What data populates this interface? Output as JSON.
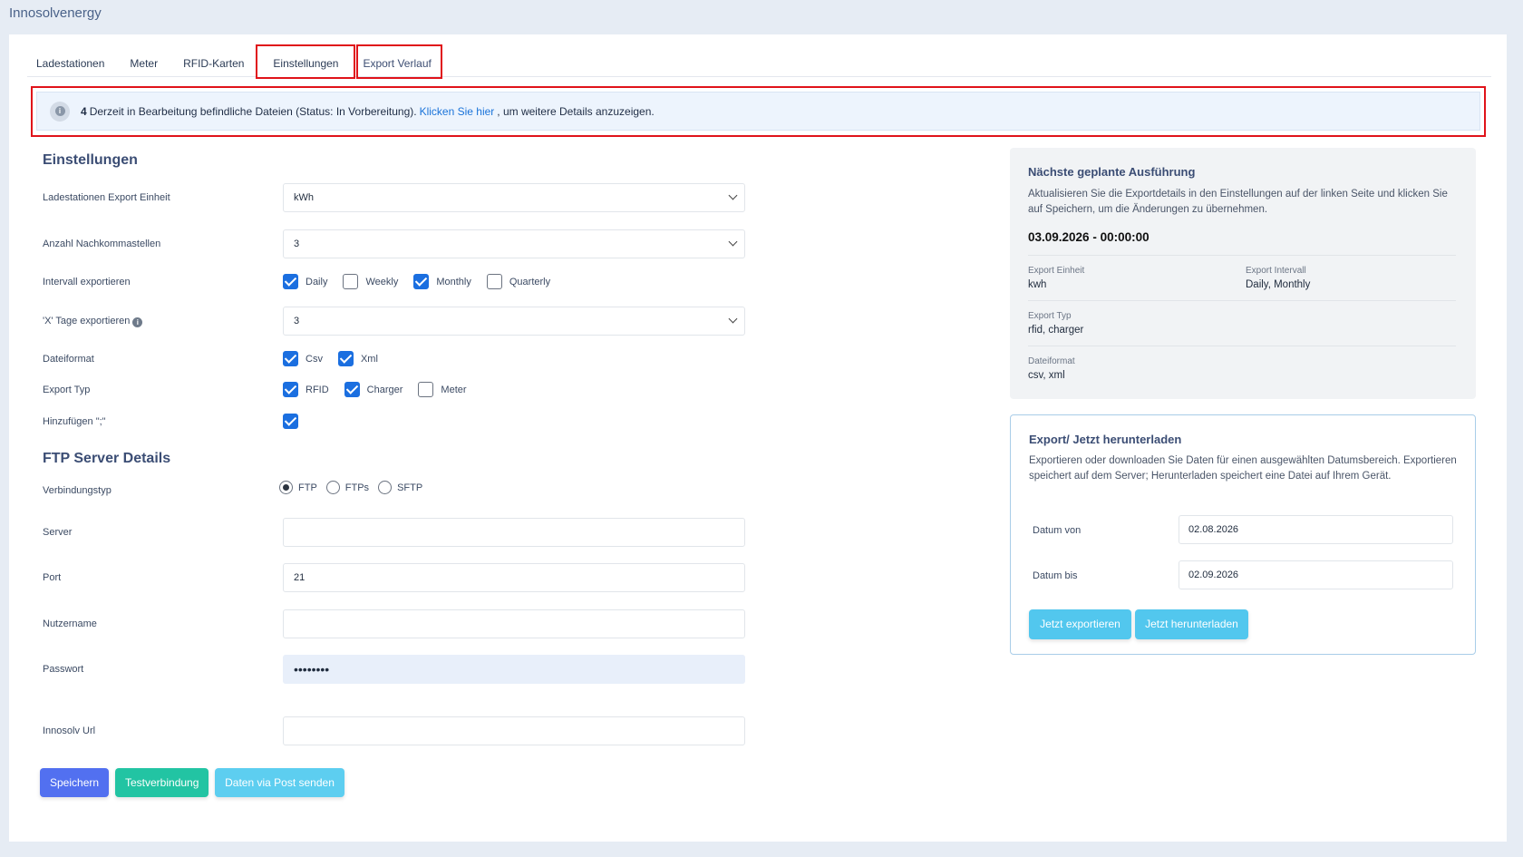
{
  "app": {
    "title": "Innosolvenergy"
  },
  "tabs": [
    {
      "label": "Ladestationen"
    },
    {
      "label": "Meter"
    },
    {
      "label": "RFID-Karten"
    },
    {
      "label": "Einstellungen"
    },
    {
      "label": "Export Verlauf"
    }
  ],
  "alert": {
    "count": "4",
    "text": "Derzeit in Bearbeitung befindliche Dateien (Status: In Vorbereitung).",
    "link": "Klicken Sie hier",
    "tail": ", um weitere Details anzuzeigen."
  },
  "settings": {
    "heading": "Einstellungen",
    "export_unit": {
      "label": "Ladestationen Export Einheit",
      "value": "kWh"
    },
    "decimals": {
      "label": "Anzahl Nachkommastellen",
      "value": "3"
    },
    "interval": {
      "label": "Intervall exportieren",
      "options": [
        {
          "label": "Daily",
          "checked": true
        },
        {
          "label": "Weekly",
          "checked": false
        },
        {
          "label": "Monthly",
          "checked": true
        },
        {
          "label": "Quarterly",
          "checked": false
        }
      ]
    },
    "x_days": {
      "label": "'X' Tage exportieren",
      "value": "3"
    },
    "file_format": {
      "label": "Dateiformat",
      "options": [
        {
          "label": "Csv",
          "checked": true
        },
        {
          "label": "Xml",
          "checked": true
        }
      ]
    },
    "export_type": {
      "label": "Export Typ",
      "options": [
        {
          "label": "RFID",
          "checked": true
        },
        {
          "label": "Charger",
          "checked": true
        },
        {
          "label": "Meter",
          "checked": false
        }
      ]
    },
    "append": {
      "label": "Hinzufügen \";\"",
      "checked": true
    }
  },
  "ftp": {
    "heading": "FTP Server Details",
    "connection": {
      "label": "Verbindungstyp",
      "options": [
        {
          "label": "FTP",
          "selected": true
        },
        {
          "label": "FTPs",
          "selected": false
        },
        {
          "label": "SFTP",
          "selected": false
        }
      ]
    },
    "server": {
      "label": "Server",
      "value": ""
    },
    "port": {
      "label": "Port",
      "value": "21"
    },
    "username": {
      "label": "Nutzername",
      "value": ""
    },
    "password": {
      "label": "Passwort",
      "value": "••••••••"
    },
    "url": {
      "label": "Innosolv Url",
      "value": ""
    }
  },
  "buttons": {
    "save": "Speichern",
    "test": "Testverbindung",
    "post": "Daten via Post senden"
  },
  "next_run": {
    "title": "Nächste geplante Ausführung",
    "text": "Aktualisieren Sie die Exportdetails in den Einstellungen auf der linken Seite und klicken Sie auf Speichern, um die Änderungen zu übernehmen.",
    "datetime": "03.09.2026 - 00:00:00",
    "unit_label": "Export Einheit",
    "unit_value": "kwh",
    "interval_label": "Export Intervall",
    "interval_value": "Daily, Monthly",
    "type_label": "Export Typ",
    "type_value": "rfid, charger",
    "format_label": "Dateiformat",
    "format_value": "csv, xml"
  },
  "export_now": {
    "title": "Export/ Jetzt herunterladen",
    "text": "Exportieren oder downloaden Sie Daten für einen ausgewählten Datumsbereich. Exportieren speichert auf dem Server; Herunterladen speichert eine Datei auf Ihrem Gerät.",
    "from_label": "Datum von",
    "from_value": "02.08.2026",
    "to_label": "Datum bis",
    "to_value": "02.09.2026",
    "export_btn": "Jetzt exportieren",
    "download_btn": "Jetzt herunterladen"
  },
  "colors": {
    "primary": "#5270f0",
    "success": "#22c4a3",
    "info": "#5dcef0",
    "checkbox": "#1b6fe0",
    "highlight": "#e0131a"
  }
}
